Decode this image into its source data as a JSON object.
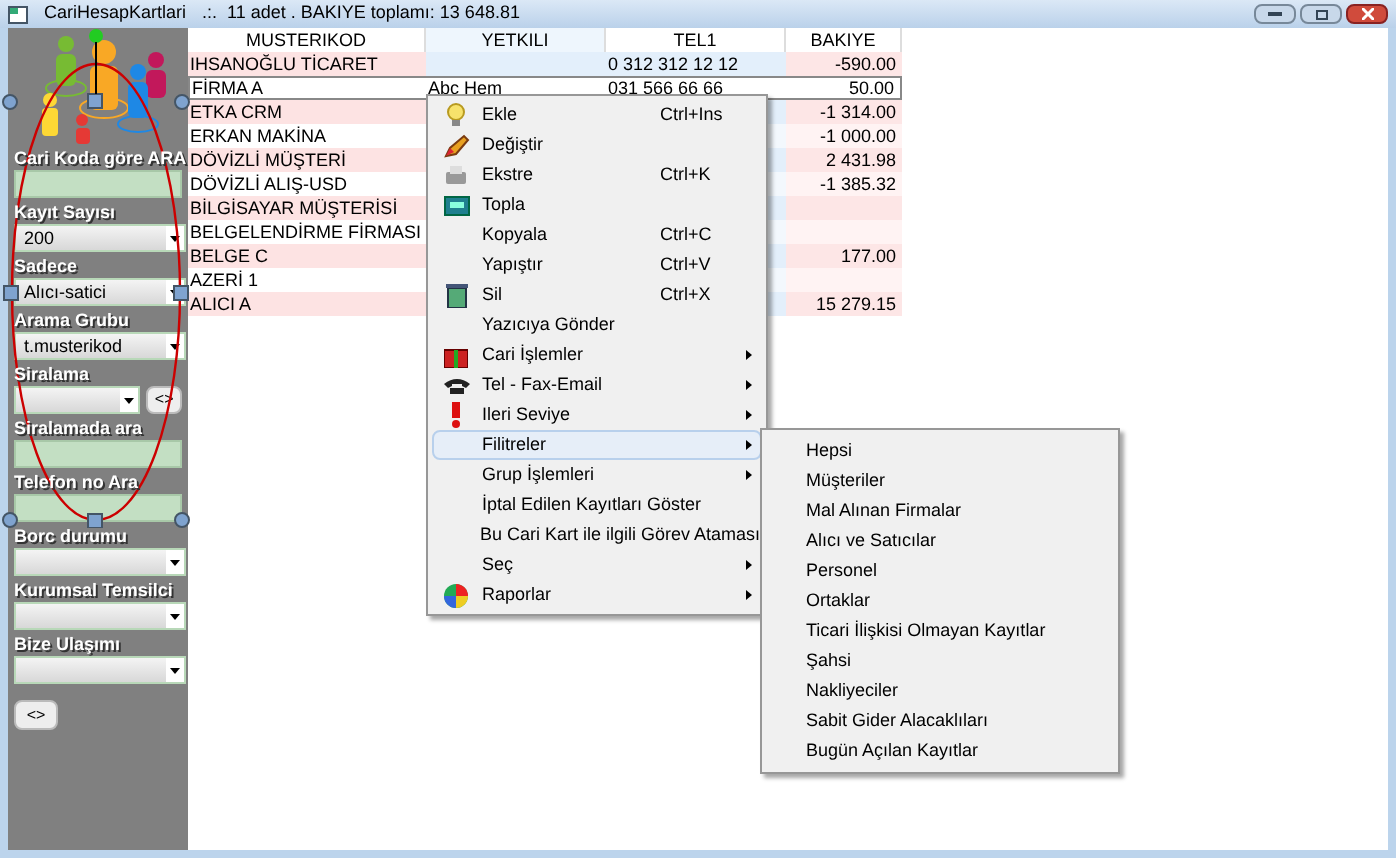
{
  "window": {
    "title": "CariHesapKartlari",
    "summary": ".:.  11 adet . BAKIYE toplamı: 13 648.81"
  },
  "filters": [
    {
      "kind": "text",
      "label": "Cari Koda göre ARA"
    },
    {
      "kind": "combo",
      "label": "Kayıt Sayısı",
      "value": "200"
    },
    {
      "kind": "combo",
      "label": "Sadece",
      "value": "Alıcı-satici"
    },
    {
      "kind": "combo",
      "label": "Arama Grubu",
      "value": "t.musterikod"
    },
    {
      "kind": "combo_button",
      "label": "Siralama",
      "button": "<>"
    },
    {
      "kind": "text",
      "label": "Siralamada ara"
    },
    {
      "kind": "text",
      "label": "Telefon no Ara"
    },
    {
      "kind": "combo",
      "label": "Borc durumu"
    },
    {
      "kind": "combo",
      "label": "Kurumsal Temsilci"
    },
    {
      "kind": "combo",
      "label": "Bize Ulaşımı"
    }
  ],
  "panel_button": "<>",
  "table": {
    "columns": [
      "MUSTERIKOD",
      "YETKILI",
      "TEL1",
      "BAKIYE"
    ],
    "rows": [
      {
        "cells": [
          "IHSANOĞLU TİCARET",
          "",
          "0 312 312 12 12",
          "-590.00"
        ],
        "selected": false
      },
      {
        "cells": [
          "FİRMA A",
          "Abc Hem",
          "031 566 66 66",
          "50.00"
        ],
        "selected": true
      },
      {
        "cells": [
          "ETKA CRM",
          "",
          "",
          "-1 314.00"
        ],
        "selected": false
      },
      {
        "cells": [
          "ERKAN MAKİNA",
          "",
          "",
          "-1 000.00"
        ],
        "selected": false
      },
      {
        "cells": [
          "DÖVİZLİ MÜŞTERİ",
          "",
          "",
          "2 431.98"
        ],
        "selected": false
      },
      {
        "cells": [
          "DÖVİZLİ ALIŞ-USD",
          "",
          "",
          "-1 385.32"
        ],
        "selected": false
      },
      {
        "cells": [
          "BİLGİSAYAR MÜŞTERİSİ",
          "",
          "",
          ""
        ],
        "selected": false
      },
      {
        "cells": [
          "BELGELENDİRME FİRMASI",
          "",
          "",
          ""
        ],
        "selected": false
      },
      {
        "cells": [
          "BELGE C",
          "",
          "",
          "177.00"
        ],
        "selected": false
      },
      {
        "cells": [
          "AZERİ 1",
          "",
          "",
          ""
        ],
        "selected": false
      },
      {
        "cells": [
          "ALICI A",
          "",
          "",
          "15 279.15"
        ],
        "selected": false
      }
    ]
  },
  "context_menu": [
    {
      "label": "Ekle",
      "shortcut": "Ctrl+Ins",
      "submenu": false,
      "selected": false
    },
    {
      "label": "Değiştir",
      "submenu": false,
      "selected": false
    },
    {
      "label": "Ekstre",
      "shortcut": "Ctrl+K",
      "submenu": false,
      "selected": false
    },
    {
      "label": "Topla",
      "submenu": false,
      "selected": false
    },
    {
      "label": "Kopyala",
      "shortcut": "Ctrl+C",
      "submenu": false,
      "selected": false
    },
    {
      "label": "Yapıştır",
      "shortcut": "Ctrl+V",
      "submenu": false,
      "selected": false
    },
    {
      "label": "Sil",
      "shortcut": "Ctrl+X",
      "submenu": false,
      "selected": false
    },
    {
      "label": "Yazıcıya Gönder",
      "submenu": false,
      "selected": false
    },
    {
      "label": "Cari İşlemler",
      "submenu": true,
      "selected": false
    },
    {
      "label": "Tel - Fax-Email",
      "submenu": true,
      "selected": false
    },
    {
      "label": "Ileri Seviye",
      "submenu": true,
      "selected": false
    },
    {
      "label": "Filitreler",
      "submenu": true,
      "selected": true
    },
    {
      "label": "Grup İşlemleri",
      "submenu": true,
      "selected": false
    },
    {
      "label": "İptal Edilen Kayıtları Göster",
      "submenu": false,
      "selected": false
    },
    {
      "label": "Bu Cari Kart ile  ilgili Görev Ataması",
      "submenu": false,
      "selected": false
    },
    {
      "label": "Seç",
      "submenu": true,
      "selected": false
    },
    {
      "label": "Raporlar",
      "submenu": true,
      "selected": false
    }
  ],
  "submenu": [
    "Hepsi",
    "Müşteriler",
    "Mal Alınan Firmalar",
    "Alıcı ve Satıcılar",
    "Personel",
    "Ortaklar",
    "Ticari İlişkisi Olmayan Kayıtlar",
    "Şahsi",
    "Nakliyeciler",
    "Sabit Gider Alacaklıları",
    "Bugün  Açılan Kayıtlar"
  ]
}
